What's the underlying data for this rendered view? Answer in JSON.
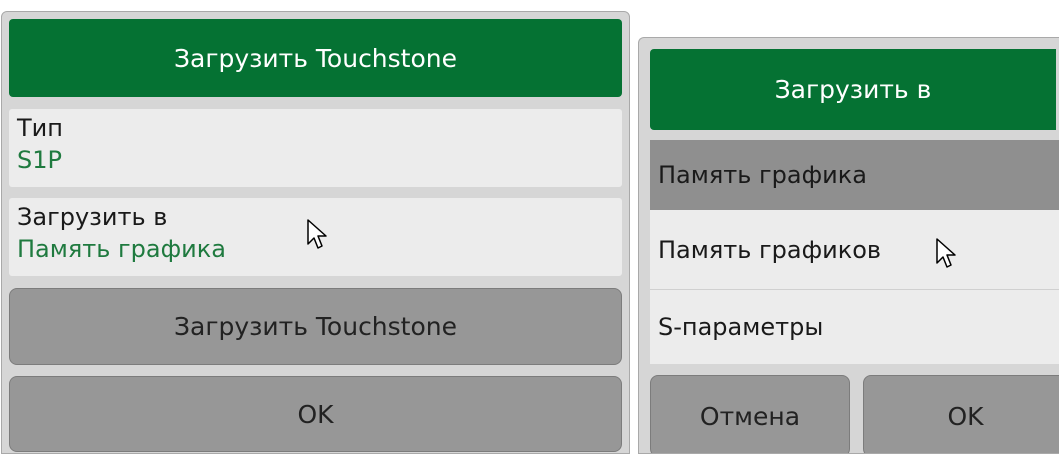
{
  "left_dialog": {
    "title": "Загрузить Touchstone",
    "type_field": {
      "label": "Тип",
      "value": "S1P"
    },
    "load_to_field": {
      "label": "Загрузить в",
      "value": "Память графика"
    },
    "load_button_label": "Загрузить Touchstone",
    "ok_button_label": "OK"
  },
  "right_dialog": {
    "title": "Загрузить в",
    "options": [
      {
        "label": "Память графика",
        "selected": true
      },
      {
        "label": "Память графиков",
        "selected": false
      },
      {
        "label": "S-параметры",
        "selected": false
      }
    ],
    "cancel_button_label": "Отмена",
    "ok_button_label": "OK"
  },
  "colors": {
    "header_green": "#057233",
    "value_green": "#1f7a3f",
    "button_gray": "#979797",
    "selected_gray": "#8f8f8f",
    "item_light": "#ececec",
    "panel_bg": "#d6d6d6"
  },
  "icons": {
    "cursor": "mouse-pointer-icon"
  }
}
